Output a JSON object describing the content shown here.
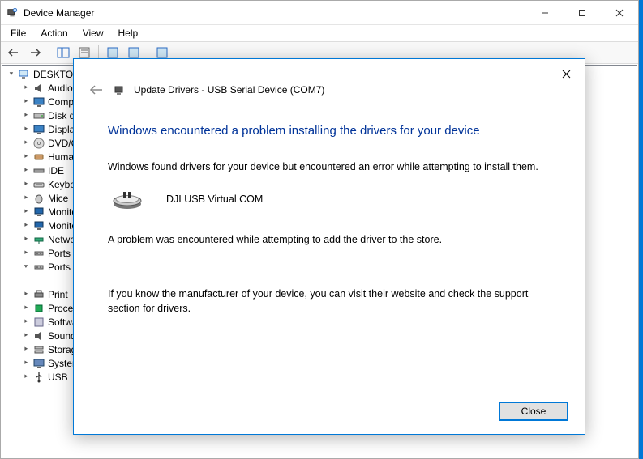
{
  "window": {
    "title": "Device Manager"
  },
  "menubar": [
    "File",
    "Action",
    "View",
    "Help"
  ],
  "tree": {
    "root": "DESKTOP",
    "children": [
      {
        "icon": "audio",
        "label": "Audio"
      },
      {
        "icon": "monitor",
        "label": "Computer"
      },
      {
        "icon": "disk",
        "label": "Disk drives"
      },
      {
        "icon": "monitor",
        "label": "Display"
      },
      {
        "icon": "dvd",
        "label": "DVD/CD"
      },
      {
        "icon": "hid",
        "label": "Human"
      },
      {
        "icon": "ide",
        "label": "IDE"
      },
      {
        "icon": "keyboard",
        "label": "Keyboard"
      },
      {
        "icon": "mouse",
        "label": "Mice"
      },
      {
        "icon": "monitor2",
        "label": "Monitors"
      },
      {
        "icon": "monitor2",
        "label": "Monitors"
      },
      {
        "icon": "network",
        "label": "Network"
      },
      {
        "icon": "port",
        "label": "Ports"
      },
      {
        "icon": "port",
        "label": "Ports",
        "expanded": true
      },
      {
        "icon": "spacer",
        "label": "",
        "child": true
      },
      {
        "icon": "printer",
        "label": "Print"
      },
      {
        "icon": "cpu",
        "label": "Processors"
      },
      {
        "icon": "software",
        "label": "Software"
      },
      {
        "icon": "audio",
        "label": "Sound"
      },
      {
        "icon": "storage",
        "label": "Storage"
      },
      {
        "icon": "system",
        "label": "System"
      },
      {
        "icon": "usb",
        "label": "USB"
      }
    ]
  },
  "dialog": {
    "back_visible": true,
    "subtitle_prefix": "Update Drivers - USB Serial Device (COM7)",
    "heading": "Windows encountered a problem installing the drivers for your device",
    "body1": "Windows found drivers for your device but encountered an error while attempting to install them.",
    "device_name": "DJI USB Virtual COM",
    "body2": "A problem was encountered while attempting to add the driver to the store.",
    "body3": "If you know the manufacturer of your device, you can visit their website and check the support section for drivers.",
    "close_label": "Close"
  }
}
